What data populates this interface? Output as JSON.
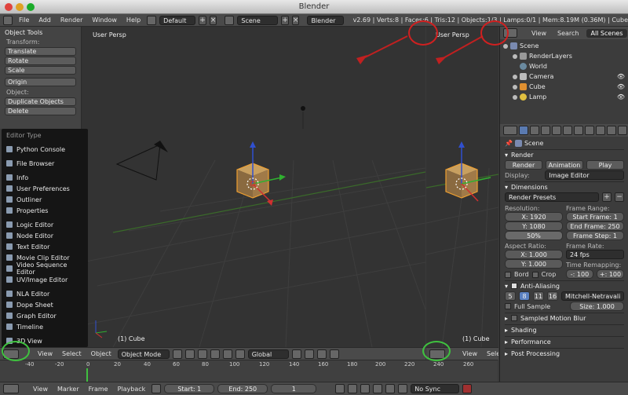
{
  "window": {
    "title": "Blender"
  },
  "info_header": {
    "menus": [
      "File",
      "Add",
      "Render",
      "Window",
      "Help"
    ],
    "screen_layout": "Default",
    "scene": "Scene",
    "render_engine": "Blender Render",
    "stats": "v2.69 | Verts:8 | Faces:6 | Tris:12 | Objects:1/3 | Lamps:0/1 | Mem:8.19M (0.36M) | Cube"
  },
  "toolshelf": {
    "title": "Object Tools",
    "transform_label": "Transform:",
    "transform_buttons": [
      "Translate",
      "Rotate",
      "Scale"
    ],
    "origin_button": "Origin",
    "object_label": "Object:",
    "object_buttons": [
      "Duplicate Objects",
      "Delete"
    ]
  },
  "editor_type_menu": {
    "title": "Editor Type",
    "items": [
      "Python Console",
      "File Browser",
      "Info",
      "User Preferences",
      "Outliner",
      "Properties",
      "Logic Editor",
      "Node Editor",
      "Text Editor",
      "Movie Clip Editor",
      "Video Sequence Editor",
      "UV/Image Editor",
      "NLA Editor",
      "Dope Sheet",
      "Graph Editor",
      "Timeline",
      "3D View"
    ]
  },
  "viewport_left": {
    "label": "User Persp",
    "object": "(1) Cube"
  },
  "viewport_right": {
    "label": "User Persp",
    "object": "(1) Cube"
  },
  "view3d_header": {
    "menus": [
      "View",
      "Select",
      "Object"
    ],
    "mode": "Object Mode",
    "orientation": "Global"
  },
  "view3d_header_right": {
    "menus": [
      "View",
      "Sele"
    ]
  },
  "timeline": {
    "ticks": [
      "-40",
      "-20",
      "0",
      "20",
      "40",
      "60",
      "80",
      "100",
      "120",
      "140",
      "160",
      "180",
      "200",
      "220",
      "240",
      "260"
    ],
    "menus": [
      "View",
      "Marker",
      "Frame",
      "Playback"
    ],
    "start": "Start: 1",
    "end": "End: 250",
    "current": "1",
    "sync": "No Sync"
  },
  "outliner": {
    "menus": [
      "View",
      "Search"
    ],
    "filter": "All Scenes",
    "items": [
      "Scene",
      "RenderLayers",
      "World",
      "Camera",
      "Cube",
      "Lamp"
    ]
  },
  "properties": {
    "context": "Scene",
    "render": {
      "title": "Render",
      "buttons": [
        "Render",
        "Animation",
        "Play"
      ],
      "display_label": "Display:",
      "display_value": "Image Editor"
    },
    "dimensions": {
      "title": "Dimensions",
      "presets": "Render Presets",
      "resolution_label": "Resolution:",
      "res_x": "X: 1920",
      "res_y": "Y: 1080",
      "res_pct": "50%",
      "frame_range_label": "Frame Range:",
      "start_frame": "Start Frame: 1",
      "end_frame": "End Frame: 250",
      "frame_step": "Frame Step: 1",
      "aspect_label": "Aspect Ratio:",
      "aspect_x": "X: 1.000",
      "aspect_y": "Y: 1.000",
      "frame_rate_label": "Frame Rate:",
      "frame_rate": "24 fps",
      "time_remap_label": "Time Remapping:",
      "remap_old": "-: 100",
      "remap_new": "+: 100",
      "border": "Bord",
      "crop": "Crop"
    },
    "anti_aliasing": {
      "title": "Anti-Aliasing",
      "samples": [
        "5",
        "8",
        "11",
        "16"
      ],
      "filter": "Mitchell-Netravali",
      "full_sample": "Full Sample",
      "size": "Size: 1.000"
    },
    "collapsed_panels": [
      "Sampled Motion Blur",
      "Shading",
      "Performance",
      "Post Processing"
    ]
  }
}
